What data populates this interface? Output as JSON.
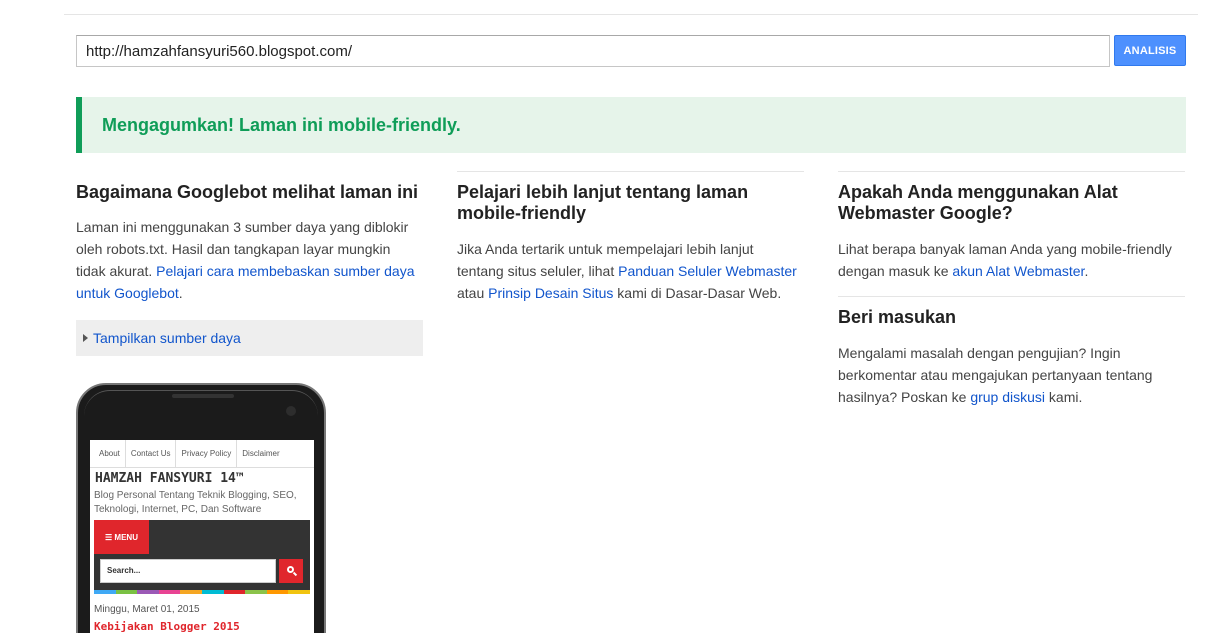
{
  "url_input": {
    "value": "http://hamzahfansyuri560.blogspot.com/"
  },
  "analyze_button": {
    "label": "ANALISIS"
  },
  "result": {
    "message": "Mengagumkan! Laman ini mobile-friendly."
  },
  "column1": {
    "heading": "Bagaimana Googlebot melihat laman ini",
    "text": "Laman ini menggunakan 3 sumber daya yang diblokir oleh robots.txt. Hasil dan tangkapan layar mungkin tidak akurat. ",
    "link": "Pelajari cara membebaskan sumber daya untuk Googlebot",
    "text_end": ".",
    "toggle_label": "Tampilkan sumber daya"
  },
  "column2": {
    "heading": "Pelajari lebih lanjut tentang laman mobile-friendly",
    "text1": "Jika Anda tertarik untuk mempelajari lebih lanjut tentang situs seluler, lihat ",
    "link1": "Panduan Seluler Webmaster",
    "text2": " atau ",
    "link2": "Prinsip Desain Situs",
    "text3": " kami di Dasar-Dasar Web."
  },
  "column3": {
    "heading1": "Apakah Anda menggunakan Alat Webmaster Google?",
    "text1": "Lihat berapa banyak laman Anda yang mobile-friendly dengan masuk ke ",
    "link1": "akun Alat Webmaster",
    "text1_end": ".",
    "heading2": "Beri masukan",
    "text2": "Mengalami masalah dengan pengujian? Ingin berkomentar atau mengajukan pertanyaan tentang hasilnya? Poskan ke ",
    "link2": "grup diskusi",
    "text2_end": " kami."
  },
  "phone_preview": {
    "nav": [
      "About",
      "Contact Us",
      "Privacy Policy",
      "Disclaimer"
    ],
    "site_title": "HAMZAH FANSYURI 14™",
    "site_description": "Blog Personal Tentang Teknik Blogging, SEO, Teknologi, Internet, PC, Dan Software",
    "menu_label": "☰ MENU",
    "search_placeholder": "Search...",
    "date": "Minggu, Maret 01, 2015",
    "post_title": "Kebijakan Blogger 2015",
    "stripe_colors": [
      "#3fa9f5",
      "#7ac143",
      "#9b59b6",
      "#e84393",
      "#f5a623",
      "#00bcd4",
      "#e0262c",
      "#8bc34a",
      "#ff9800",
      "#f1c40f"
    ]
  },
  "colors": {
    "accent_blue": "#4d90fe",
    "success_green": "#0f9d58",
    "link_blue": "#1155cc"
  }
}
